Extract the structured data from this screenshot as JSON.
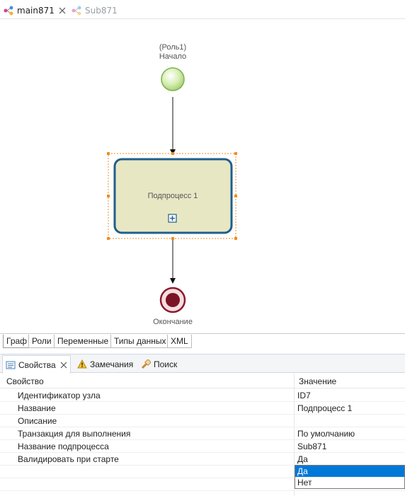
{
  "editor_tabs": [
    {
      "label": "main871",
      "active": true
    },
    {
      "label": "Sub871",
      "active": false
    }
  ],
  "diagram": {
    "start_node": {
      "role": "(Роль1)",
      "label": "Начало"
    },
    "subprocess_node": {
      "label": "Подпроцесс 1"
    },
    "end_node": {
      "label": "Окончание"
    }
  },
  "graph_tabs": [
    "Граф",
    "Роли",
    "Переменные",
    "Типы данных",
    "XML"
  ],
  "view_tabs": [
    {
      "label": "Свойства",
      "icon": "properties-icon"
    },
    {
      "label": "Замечания",
      "icon": "warning-icon"
    },
    {
      "label": "Поиск",
      "icon": "search-icon"
    }
  ],
  "properties": {
    "header_property": "Свойство",
    "header_value": "Значение",
    "rows": [
      {
        "key": "Идентификатор узла",
        "value": "ID7"
      },
      {
        "key": "Название",
        "value": "Подпроцесс 1"
      },
      {
        "key": "Описание",
        "value": ""
      },
      {
        "key": "Транзакция для выполнения",
        "value": "По умолчанию"
      },
      {
        "key": "Название подпроцесса",
        "value": "Sub871"
      },
      {
        "key": "Валидировать при старте",
        "value": "Да"
      }
    ]
  },
  "dropdown": {
    "options": [
      "Да",
      "Нет"
    ],
    "selected": "Да"
  },
  "colors": {
    "start_fill": "#cfe8a8",
    "subprocess_fill": "#e8e7c4",
    "subprocess_border": "#1f5f8b",
    "end_fill": "#8b1a2a",
    "selection_handle": "#f28c1f",
    "accent": "#0078d7"
  }
}
